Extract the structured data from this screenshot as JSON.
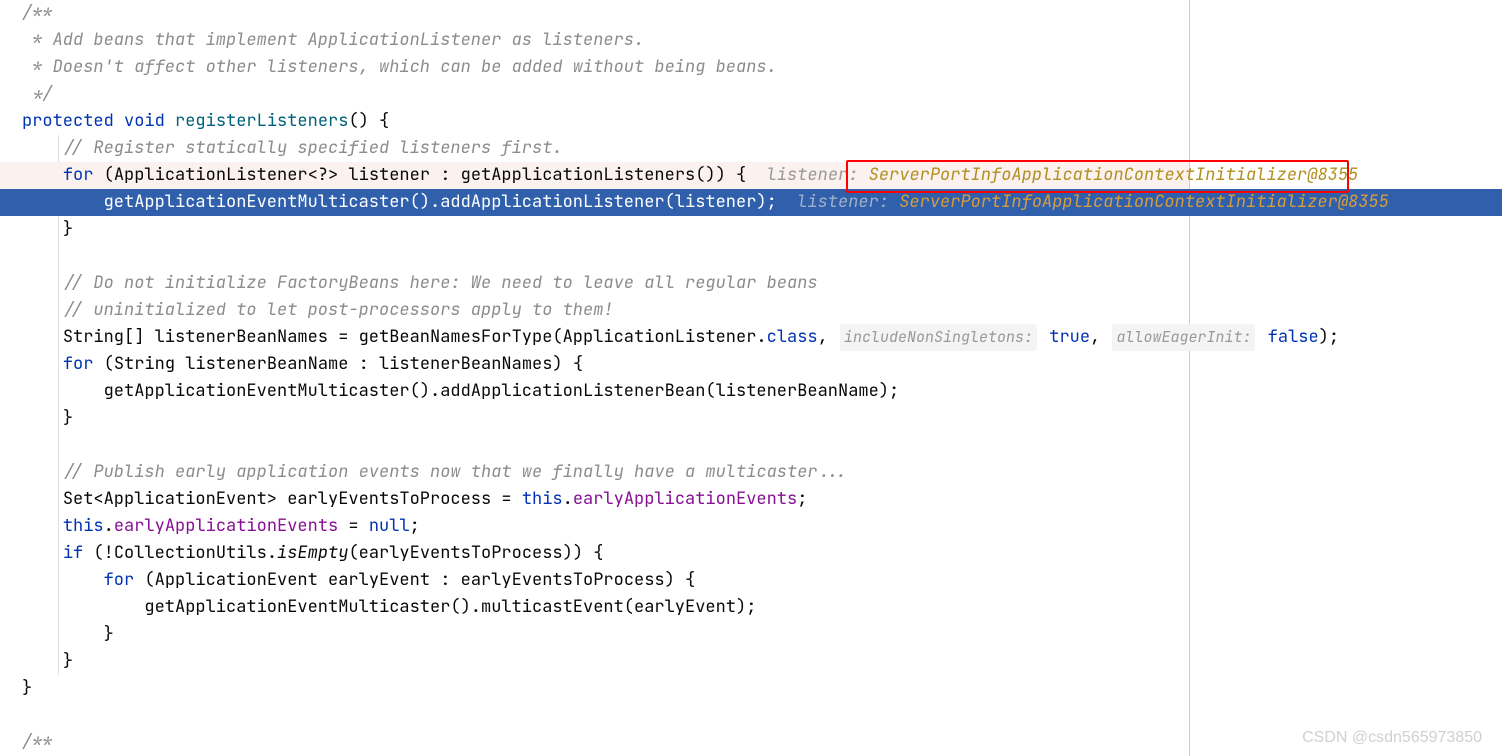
{
  "watermark": "CSDN @csdn565973850",
  "code": {
    "comment1": "/**",
    "comment2": " * Add beans that implement ApplicationListener as listeners.",
    "comment3": " * Doesn't affect other listeners, which can be added without being beans.",
    "comment4": " */",
    "kw_protected": "protected",
    "kw_void": "void",
    "method_name": "registerListeners",
    "paren_open": "() {",
    "comment5": "// Register statically specified listeners first.",
    "kw_for": "for",
    "for_open": " (ApplicationListener<?> listener : ",
    "getAppListeners": "getApplicationListeners",
    "for_close": "()) {",
    "inlay_listener1": "  listener: ",
    "inlay_value1": "ServerPortInfoApplicationContextInitializer@8355",
    "exec_line": "getApplicationEventMulticaster().addApplicationListener(listener);",
    "inlay_listener2": "  listener:",
    "inlay_value2": " ServerPortInfoApplicationContextInitializer@8355",
    "brace_close": "}",
    "comment6": "// Do not initialize FactoryBeans here: We need to leave all regular beans",
    "comment7": "// uninitialized to let post-processors apply to them!",
    "l9_pre": "String[] listenerBeanNames = getBeanNamesForType(ApplicationListener.",
    "kw_class": "class",
    "l9_post": ", ",
    "inlay_singletons": "includeNonSingletons:",
    "kw_true": " true",
    "l9_sep": ", ",
    "inlay_eager": "allowEagerInit:",
    "kw_false": " false",
    "l9_end": ");",
    "l10_pre": " (String listenerBeanName : listenerBeanNames) {",
    "l11": "getApplicationEventMulticaster().addApplicationListenerBean(listenerBeanName);",
    "comment8": "// Publish early application events now that we finally have a multicaster...",
    "l13_pre": "Set<ApplicationEvent> earlyEventsToProcess = ",
    "kw_this": "this",
    "l13_dot": ".",
    "field_early": "earlyApplicationEvents",
    "l13_end": ";",
    "l14_pre": " = ",
    "kw_null": "null",
    "l14_end": ";",
    "kw_if": "if",
    "l15_pre": " (!CollectionUtils.",
    "isEmpty": "isEmpty",
    "l15_post": "(earlyEventsToProcess)) {",
    "l16_pre": " (ApplicationEvent earlyEvent : earlyEventsToProcess) {",
    "l17": "getApplicationEventMulticaster().multicastEvent(earlyEvent);",
    "comment_end": "/**"
  },
  "annotation_box": {
    "highlighted_text": "ServerPortInfoApplicationContextInitializer@8355"
  }
}
